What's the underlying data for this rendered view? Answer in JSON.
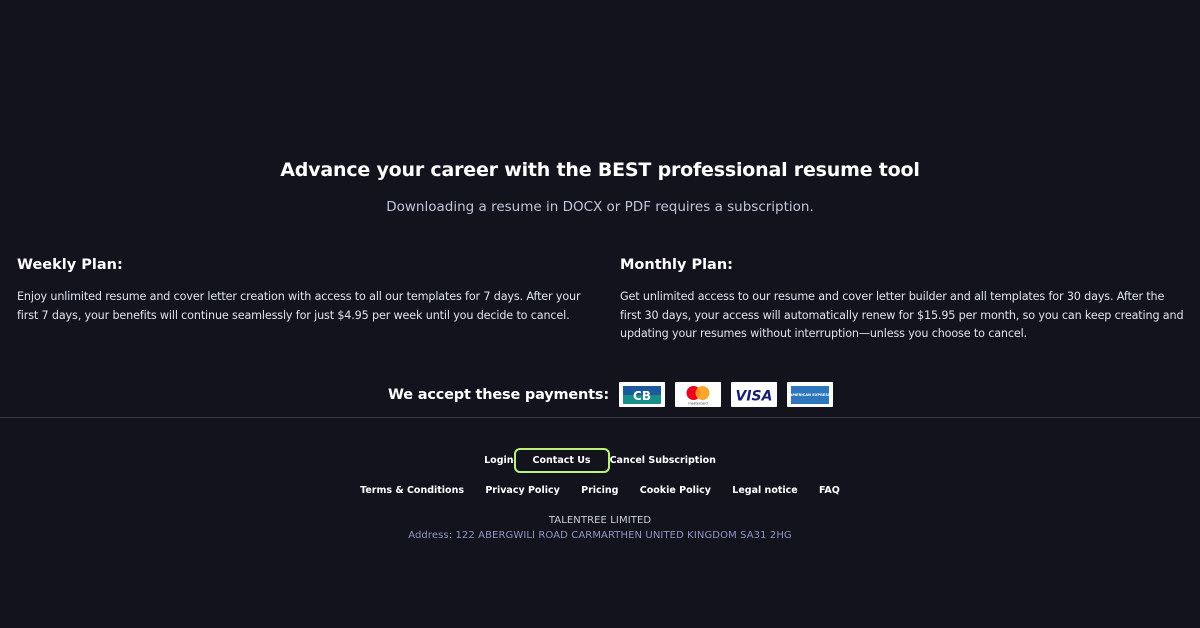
{
  "hero": {
    "headline": "Advance your career with the BEST professional resume tool",
    "subhead": "Downloading a resume in DOCX or PDF requires a subscription."
  },
  "plans": {
    "weekly": {
      "title": "Weekly Plan:",
      "description": "Enjoy unlimited resume and cover letter creation with access to all our templates for 7 days. After your first 7 days, your benefits will continue seamlessly for just $4.95 per week until you decide to cancel."
    },
    "monthly": {
      "title": "Monthly Plan:",
      "description": "Get unlimited access to our resume and cover letter builder and all templates for 30 days. After the first 30 days, your access will automatically renew for $15.95 per month, so you can keep creating and updating your resumes without interruption—unless you choose to cancel."
    }
  },
  "payments": {
    "label": "We accept these payments:",
    "cards": [
      {
        "name": "cb-card-icon",
        "text": "CB"
      },
      {
        "name": "mastercard-icon",
        "text": "mastercard"
      },
      {
        "name": "visa-icon",
        "text": "VISA"
      },
      {
        "name": "american-express-icon",
        "text": "AMERICAN EXPRESS"
      }
    ]
  },
  "footer": {
    "login": "Login",
    "contact_us": "Contact Us",
    "cancel_subscription": "Cancel Subscription",
    "links": [
      "Terms & Conditions",
      "Privacy Policy",
      "Pricing",
      "Cookie Policy",
      "Legal notice",
      "FAQ"
    ],
    "company": "TALENTREE LIMITED",
    "address": "Address: 122 ABERGWILI ROAD CARMARTHEN UNITED KINGDOM SA31 2HG"
  },
  "colors": {
    "background": "#12131d",
    "highlight": "#b9f27a",
    "address": "#8f95c4",
    "cb_blue": "#1c5a9c",
    "cb_teal": "#1a8f8a",
    "mc_red": "#eb001b",
    "mc_orange": "#f79e1b",
    "visa_blue": "#1a1f71",
    "amex_blue": "#2e77bc"
  }
}
